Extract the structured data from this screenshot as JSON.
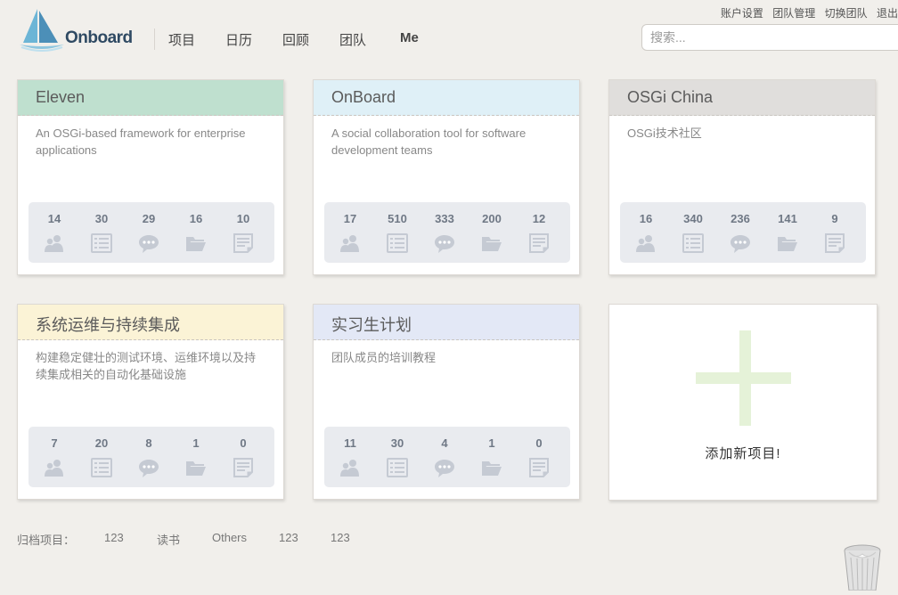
{
  "account_links": [
    "账户设置",
    "团队管理",
    "切换团队",
    "退出"
  ],
  "brand": {
    "name": "Onboard"
  },
  "nav": {
    "items": [
      "项目",
      "日历",
      "回顾",
      "团队",
      "Me"
    ]
  },
  "search": {
    "placeholder": "搜索..."
  },
  "projects": [
    {
      "title": "Eleven",
      "header_color": "#bfe0cf",
      "description": "An OSGi-based framework for enterprise applications",
      "stats": {
        "members": "14",
        "tasks": "30",
        "discussions": "29",
        "files": "16",
        "documents": "10"
      }
    },
    {
      "title": "OnBoard",
      "header_color": "#dff0f7",
      "description": "A social collaboration tool for software development teams",
      "stats": {
        "members": "17",
        "tasks": "510",
        "discussions": "333",
        "files": "200",
        "documents": "12"
      }
    },
    {
      "title": "OSGi China",
      "header_color": "#e0dedc",
      "description": "OSGi技术社区",
      "stats": {
        "members": "16",
        "tasks": "340",
        "discussions": "236",
        "files": "141",
        "documents": "9"
      }
    },
    {
      "title": "系统运维与持续集成",
      "header_color": "#fbf3d6",
      "description": "构建稳定健壮的测试环境、运维环境以及持续集成相关的自动化基础设施",
      "stats": {
        "members": "7",
        "tasks": "20",
        "discussions": "8",
        "files": "1",
        "documents": "0"
      }
    },
    {
      "title": "实习生计划",
      "header_color": "#e3e8f6",
      "description": "团队成员的培训教程",
      "stats": {
        "members": "11",
        "tasks": "30",
        "discussions": "4",
        "files": "1",
        "documents": "0"
      }
    }
  ],
  "add_project": {
    "label": "添加新项目!"
  },
  "archived": {
    "label": "归档项目：",
    "items": [
      "123",
      "读书",
      "Others",
      "123",
      "123"
    ]
  },
  "icons": {
    "members": "users-icon",
    "tasks": "task-list-icon",
    "discussions": "chat-bubble-icon",
    "files": "folder-icon",
    "documents": "document-icon",
    "trash": "trash-can-icon",
    "logo": "sailboat-logo-icon"
  }
}
